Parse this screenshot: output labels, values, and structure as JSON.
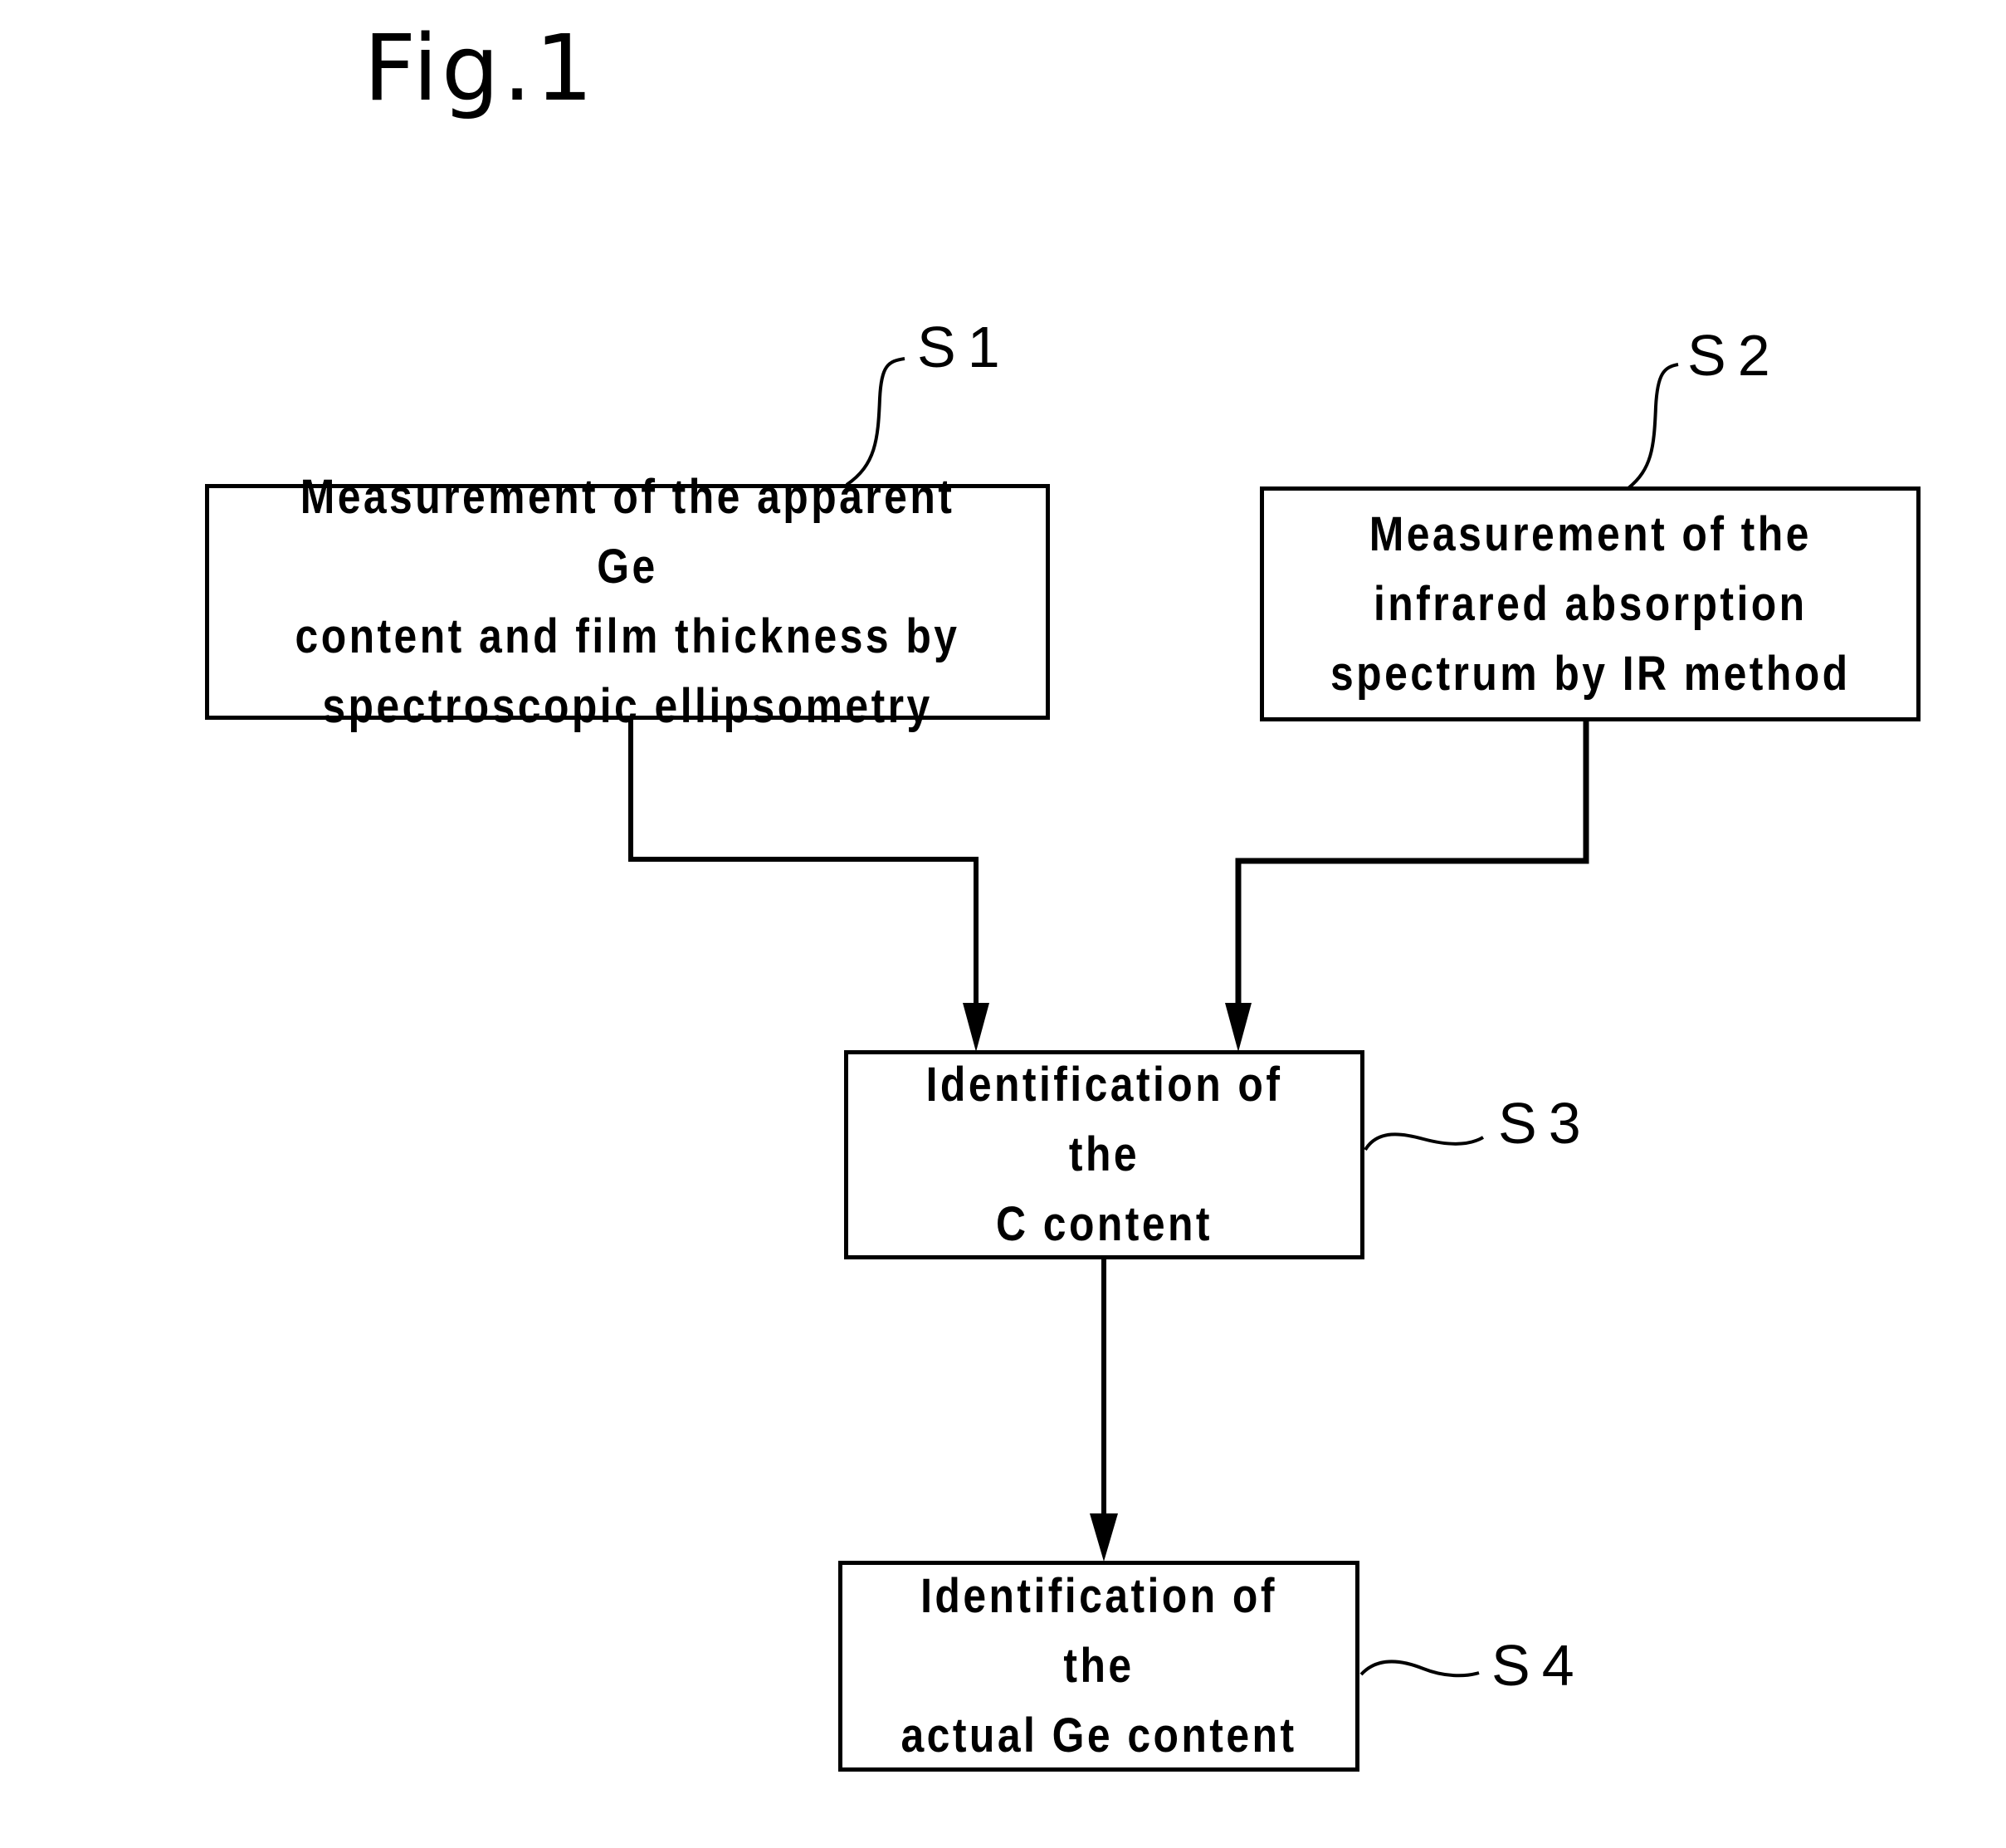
{
  "figure": {
    "title": "Fig.1"
  },
  "steps": [
    {
      "id": "S1",
      "label": "S1",
      "text": "Measurement of the apparent Ge\ncontent and film thickness by\nspectroscopic ellipsometry"
    },
    {
      "id": "S2",
      "label": "S2",
      "text": "Measurement of the\ninfrared absorption\nspectrum by IR method"
    },
    {
      "id": "S3",
      "label": "S3",
      "text": "Identification of the\nC content"
    },
    {
      "id": "S4",
      "label": "S4",
      "text": "Identification of the\nactual Ge content"
    }
  ],
  "flows": [
    {
      "from": "S1",
      "to": "S3"
    },
    {
      "from": "S2",
      "to": "S3"
    },
    {
      "from": "S3",
      "to": "S4"
    }
  ]
}
